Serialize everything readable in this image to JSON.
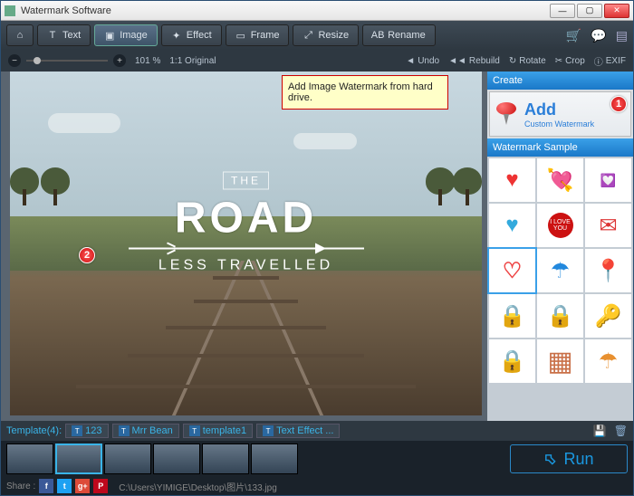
{
  "window": {
    "title": "Watermark Software"
  },
  "toolbar": {
    "home_icon": "⌂",
    "tabs": [
      {
        "icon": "T",
        "label": "Text"
      },
      {
        "icon": "▣",
        "label": "Image"
      },
      {
        "icon": "✦",
        "label": "Effect"
      },
      {
        "icon": "▭",
        "label": "Frame"
      },
      {
        "icon": "⤢",
        "label": "Resize"
      },
      {
        "icon": "AB",
        "label": "Rename"
      }
    ]
  },
  "zoom": {
    "percent": "101 %",
    "scale_label": "1:1 Original"
  },
  "actions": {
    "undo": "Undo",
    "rebuild": "Rebuild",
    "rotate": "Rotate",
    "crop": "Crop",
    "exif": "EXIF"
  },
  "tooltip": "Add Image Watermark from hard drive.",
  "overlay": {
    "the": "THE",
    "road": "ROAD",
    "less": "LESS TRAVELLED"
  },
  "side": {
    "create_header": "Create",
    "add_title": "Add",
    "add_sub": "Custom Watermark",
    "sample_header": "Watermark Sample",
    "badge1": "1",
    "samples": {
      "ilove": "I LOVE YOU"
    }
  },
  "badge2": "2",
  "templates": {
    "label": "Template(4):",
    "items": [
      "123",
      "Mrr Bean",
      "template1",
      "Text Effect ..."
    ]
  },
  "run": "Run",
  "share": {
    "label": "Share :",
    "path": "C:\\Users\\YIMIGE\\Desktop\\图片\\133.jpg"
  }
}
